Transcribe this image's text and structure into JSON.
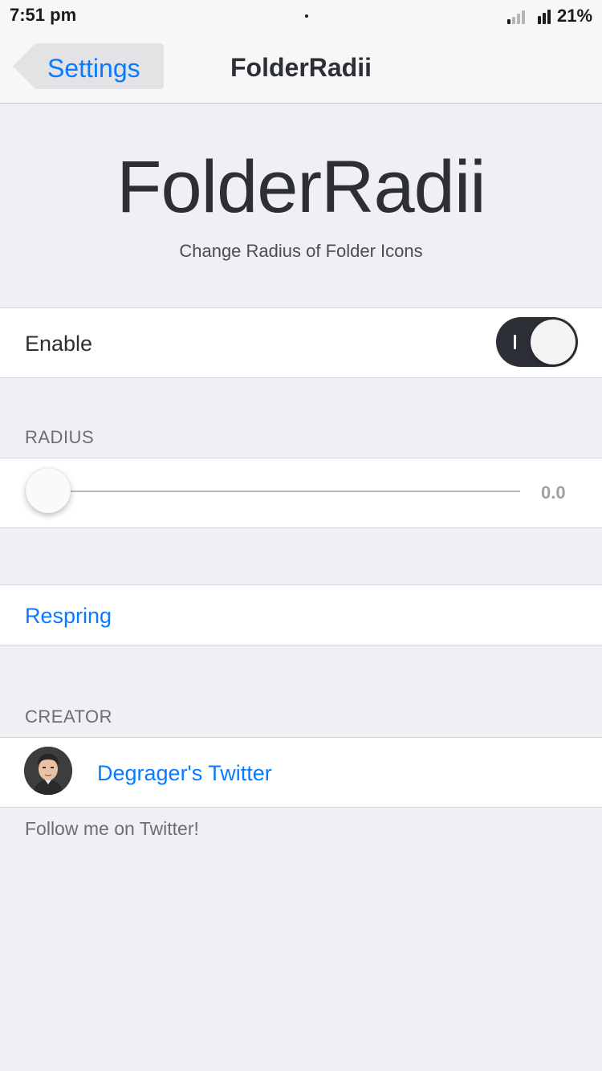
{
  "status_bar": {
    "time": "7:51 pm",
    "battery": "21%"
  },
  "nav": {
    "back_label": "Settings",
    "title": "FolderRadii"
  },
  "header": {
    "title": "FolderRadii",
    "subtitle": "Change Radius of Folder Icons"
  },
  "enable": {
    "label": "Enable",
    "toggle_on": true
  },
  "radius": {
    "section_title": "RADIUS",
    "value_text": "0.0",
    "slider_fraction": 0.0
  },
  "respring": {
    "label": "Respring"
  },
  "creator": {
    "section_title": "CREATOR",
    "link_label": "Degrager's Twitter",
    "footer": "Follow me on Twitter!"
  },
  "colors": {
    "accent": "#0a7aff",
    "background": "#efeff4",
    "toggle_on": "#2c2f36"
  },
  "icons": {
    "back": "chevron-left-icon",
    "signal": "cellular-signal-icon",
    "avatar": "avatar-portrait"
  }
}
